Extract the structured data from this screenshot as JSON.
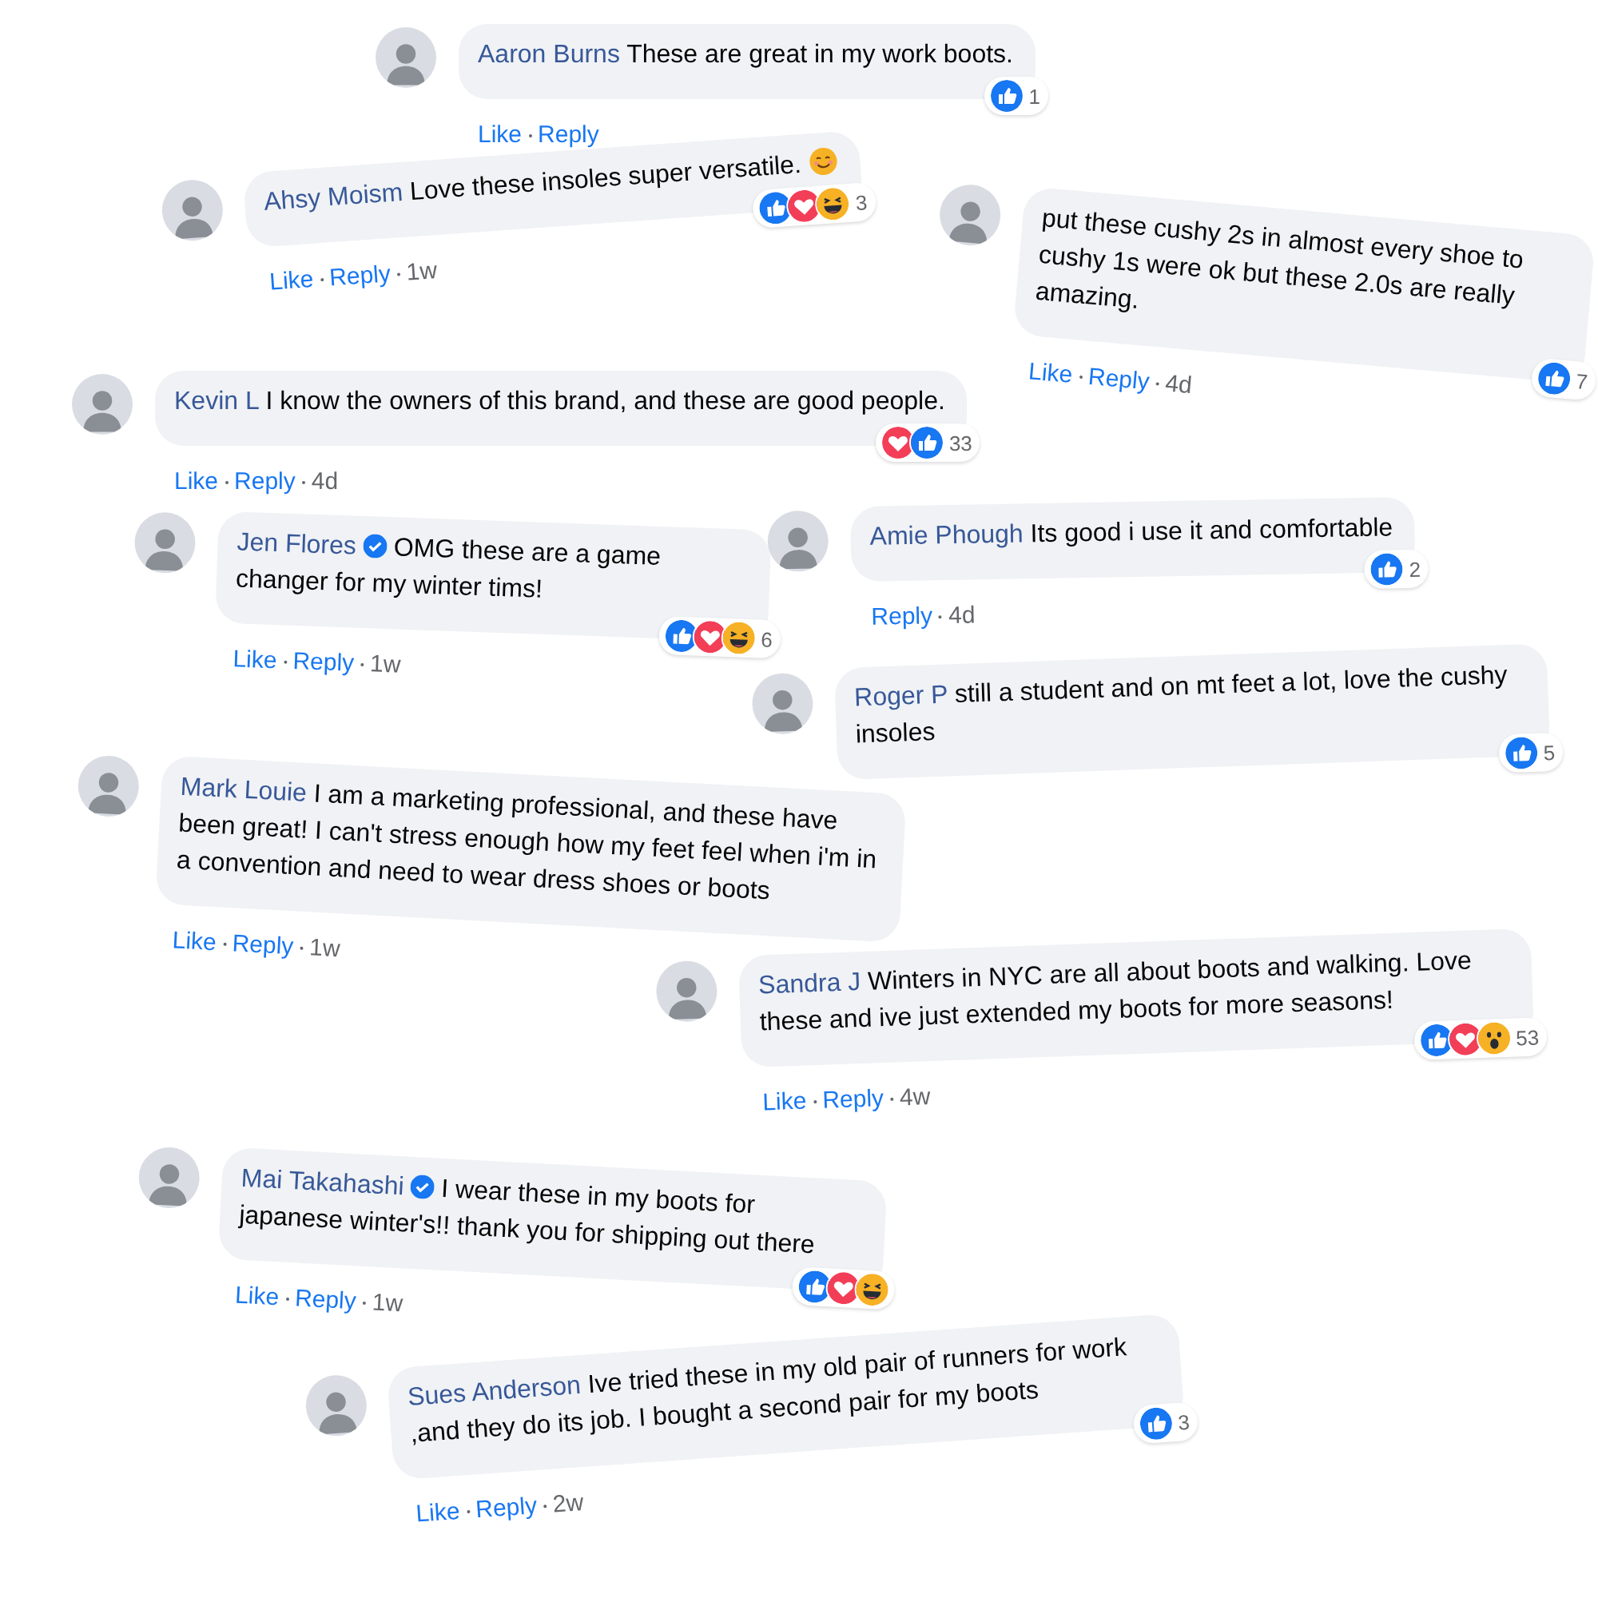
{
  "comments": [
    {
      "author": "Aaron Burns",
      "verified": false,
      "text": "These are great in my work boots.",
      "actions": [
        {
          "label": "Like"
        },
        {
          "label": "Reply"
        }
      ],
      "reactions": [
        {
          "kind": "like"
        }
      ],
      "count": "1"
    },
    {
      "author": "Ahsy Moism",
      "verified": false,
      "text": "Love these insoles super versatile.",
      "smiley": true,
      "actions": [
        {
          "label": "Like"
        },
        {
          "label": "Reply"
        }
      ],
      "time": "1w",
      "reactions": [
        {
          "kind": "like"
        },
        {
          "kind": "love"
        },
        {
          "kind": "haha"
        }
      ],
      "count": "3"
    },
    {
      "verified": false,
      "text": "put these cushy 2s in almost every shoe to cushy 1s were ok but these 2.0s are really amazing.",
      "actions": [
        {
          "label": "Like"
        },
        {
          "label": "Reply"
        }
      ],
      "time": "4d",
      "reactions": [
        {
          "kind": "like"
        }
      ],
      "count": "7"
    },
    {
      "author": "Kevin L",
      "verified": false,
      "text": "I know the owners of this brand, and these are good people.",
      "actions": [
        {
          "label": "Like"
        },
        {
          "label": "Reply"
        }
      ],
      "time": "4d",
      "reactions": [
        {
          "kind": "love"
        },
        {
          "kind": "like"
        }
      ],
      "count": "33"
    },
    {
      "author": "Jen Flores",
      "verified": true,
      "text": "OMG these are a game changer for my winter tims!",
      "actions": [
        {
          "label": "Like"
        },
        {
          "label": "Reply"
        }
      ],
      "time": "1w",
      "reactions": [
        {
          "kind": "like"
        },
        {
          "kind": "love"
        },
        {
          "kind": "haha"
        }
      ],
      "count": "6"
    },
    {
      "author": "Amie Phough",
      "verified": false,
      "text": "Its good i use it and comfortable",
      "actions": [
        {
          "label": "Reply"
        }
      ],
      "time": "4d",
      "reactions": [
        {
          "kind": "like"
        }
      ],
      "count": "2"
    },
    {
      "author": "Roger P",
      "verified": false,
      "text": "still a student and on mt feet a lot, love the cushy insoles",
      "reactions": [
        {
          "kind": "like"
        }
      ],
      "count": "5"
    },
    {
      "author": "Mark Louie",
      "verified": false,
      "text": "I am a marketing professional, and these have been great! I can't stress enough how my feet feel when i'm in a convention and need to wear dress shoes or boots",
      "actions": [
        {
          "label": "Like"
        },
        {
          "label": "Reply"
        }
      ],
      "time": "1w"
    },
    {
      "author": "Sandra J",
      "verified": false,
      "text": "Winters in NYC are all about boots and walking. Love these and ive just extended my boots for more seasons!",
      "actions": [
        {
          "label": "Like"
        },
        {
          "label": "Reply"
        }
      ],
      "time": "4w",
      "reactions": [
        {
          "kind": "like"
        },
        {
          "kind": "love"
        },
        {
          "kind": "wow"
        }
      ],
      "count": "53"
    },
    {
      "author": "Mai Takahashi",
      "verified": true,
      "text": "I wear these in my boots for japanese winter's!! thank you for shipping out there",
      "actions": [
        {
          "label": "Like"
        },
        {
          "label": "Reply"
        }
      ],
      "time": "1w",
      "reactions": [
        {
          "kind": "like"
        },
        {
          "kind": "love"
        },
        {
          "kind": "haha"
        }
      ]
    },
    {
      "author": "Sues Anderson",
      "verified": false,
      "text": "Ive tried these in my old pair of runners for work ,and they do its job. I bought a second pair for my boots",
      "actions": [
        {
          "label": "Like"
        },
        {
          "label": "Reply"
        }
      ],
      "time": "2w",
      "reactions": [
        {
          "kind": "like"
        }
      ],
      "count": "3"
    }
  ]
}
